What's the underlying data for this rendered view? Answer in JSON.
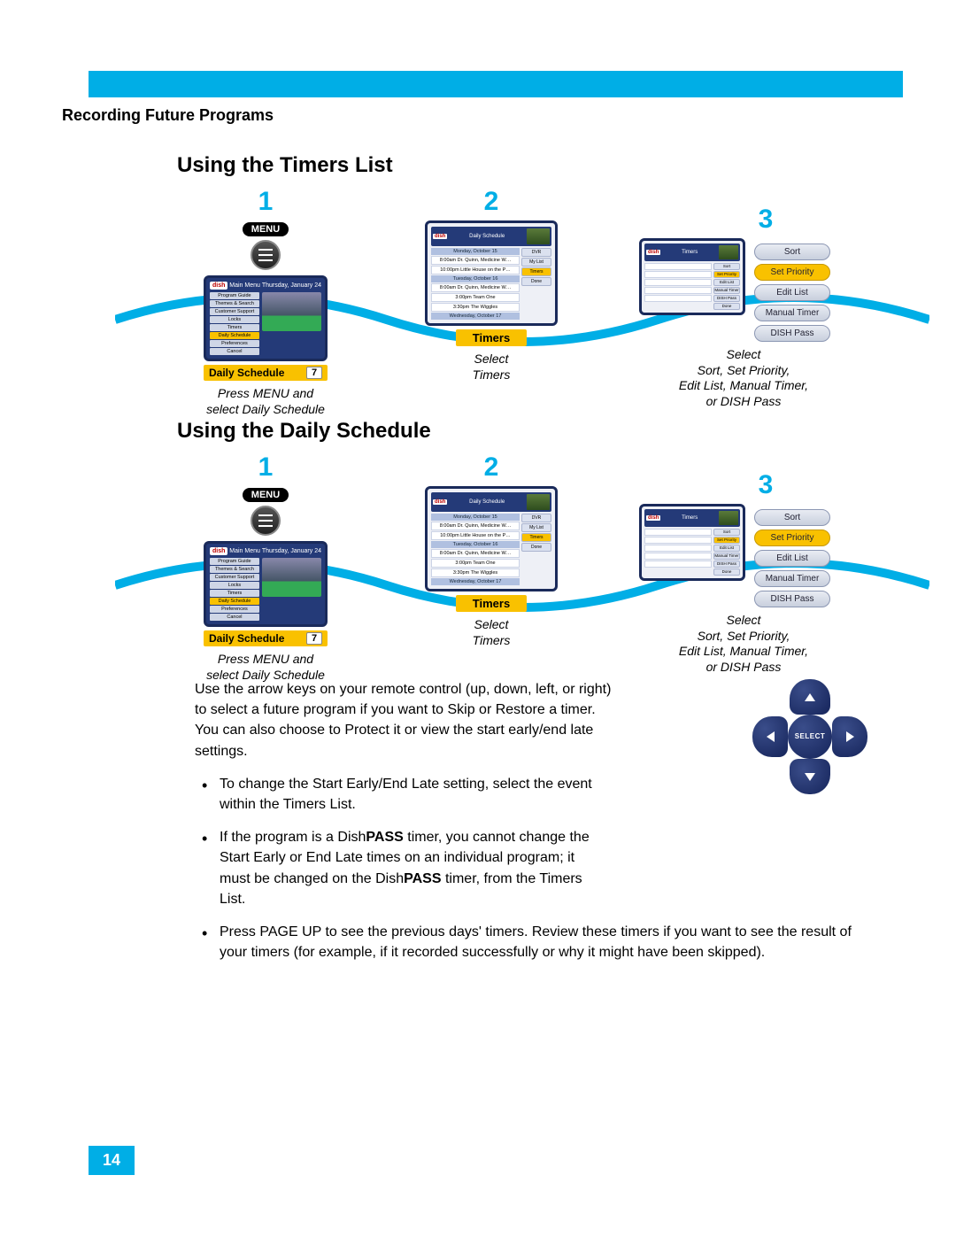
{
  "page": {
    "section_title": "Recording Future Programs",
    "number": "14"
  },
  "headings": {
    "timers": "Using the Timers List",
    "daily": "Using the Daily Schedule"
  },
  "step_numbers": {
    "one": "1",
    "two": "2",
    "three": "3"
  },
  "menu_badge": "MENU",
  "step1": {
    "logo": "dish",
    "header": "Main Menu",
    "date": "Thursday, January 24",
    "items": [
      "Program Guide",
      "Themes & Search",
      "Customer Support",
      "Locks",
      "Timers",
      "Preferences",
      "Cancel"
    ],
    "highlight_item": "Daily Schedule",
    "ds_label": "Daily Schedule",
    "ds_num": "7",
    "caption_l1": "Press MENU and",
    "caption_l2": "select Daily Schedule"
  },
  "step2": {
    "logo": "dish",
    "header": "Daily Schedule",
    "dates": [
      "Monday, October 15",
      "Tuesday, October 16",
      "Wednesday, October 17"
    ],
    "rows": [
      "8:00am  Dr. Quinn, Medicine W…",
      "10:00pm  Little House on the P…",
      "8:00am  Dr. Quinn, Medicine W…",
      "3:00pm  Team One",
      "3:30pm  The Wiggles"
    ],
    "side_buttons": [
      "DVR",
      "My List",
      "Timers",
      "Done"
    ],
    "highlight_side": "Timers",
    "timers_btn": "Timers",
    "caption_l1": "Select",
    "caption_l2": "Timers"
  },
  "step3": {
    "logo": "dish",
    "header": "Timers",
    "side_buttons": [
      "Sort",
      "Set Priority",
      "Edit List",
      "Manual Timer",
      "DISH Pass",
      "Done"
    ],
    "stack": [
      "Sort",
      "Set Priority",
      "Edit List",
      "Manual Timer",
      "DISH Pass"
    ],
    "stack_hl": "Set Priority",
    "caption_l1": "Select",
    "caption_l2": "Sort, Set Priority,",
    "caption_l3": "Edit List, Manual Timer,",
    "caption_l4": "or DISH Pass"
  },
  "body": {
    "intro": "Use the arrow keys on your remote control (up, down, left, or right) to select a future program if you want to Skip or Restore a timer. You can also choose to Protect it or view the start early/end late settings.",
    "bullet1": "To change the Start Early/End Late setting, select the event within the Timers List.",
    "bullet2_pre": "If the program is a Dish",
    "bullet2_pass": "PASS",
    "bullet2_mid": " timer, you cannot change the Start Early or End Late times on an individual program; it must be changed on the Dish",
    "bullet2_pass2": "PASS",
    "bullet2_post": " timer, from the Timers List.",
    "bullet3": "Press PAGE UP to see the previous days' timers. Review these timers if you want to see the result of your timers (for example, if it recorded successfully or why it might have been skipped)."
  },
  "dpad": {
    "center": "SELECT"
  }
}
